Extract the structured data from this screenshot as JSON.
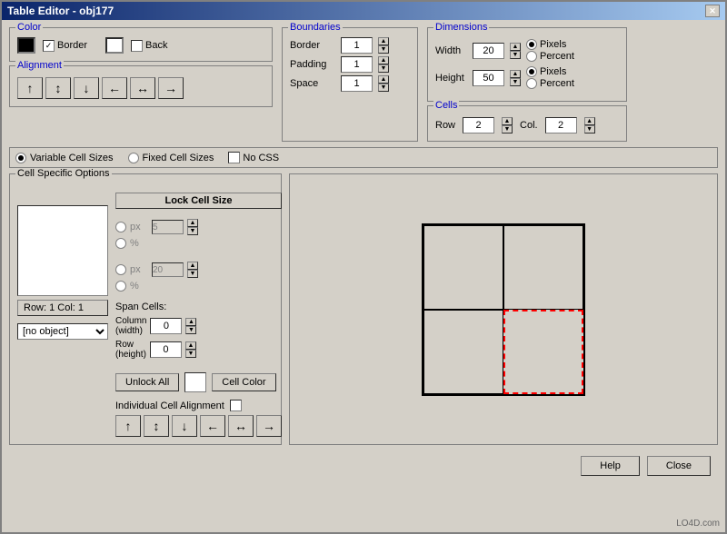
{
  "window": {
    "title": "Table Editor - obj177",
    "close_btn": "✕"
  },
  "color_group": {
    "title": "Color",
    "border_label": "Border",
    "back_label": "Back",
    "border_checked": true,
    "back_checked": false
  },
  "alignment_group": {
    "title": "Alignment",
    "buttons": [
      "↑",
      "↕",
      "↓",
      "←",
      "↔",
      "→"
    ]
  },
  "boundaries_group": {
    "title": "Boundaries",
    "border_label": "Border",
    "border_value": "1",
    "padding_label": "Padding",
    "padding_value": "1",
    "space_label": "Space",
    "space_value": "1"
  },
  "dimensions_group": {
    "title": "Dimensions",
    "width_label": "Width",
    "width_value": "20",
    "height_label": "Height",
    "height_value": "50",
    "pixels_label": "Pixels",
    "percent_label": "Percent",
    "width_pixels_selected": true,
    "height_pixels_selected": true
  },
  "cells_group": {
    "title": "Cells",
    "row_label": "Row",
    "row_value": "2",
    "col_label": "Col.",
    "col_value": "2"
  },
  "cell_sizes": {
    "variable_label": "Variable Cell Sizes",
    "fixed_label": "Fixed Cell Sizes",
    "no_css_label": "No CSS",
    "variable_selected": true
  },
  "cell_options": {
    "title": "Cell Specific Options",
    "lock_btn": "Lock Cell Size",
    "px1_label": "px",
    "percent1_label": "%",
    "px1_value": "5",
    "px2_label": "px",
    "percent2_label": "%",
    "px2_value": "20",
    "span_cells_label": "Span Cells:",
    "column_label": "Column",
    "column_sub": "(width)",
    "column_value": "0",
    "row_label": "Row",
    "row_sub": "(height)",
    "row_value": "0",
    "unlock_btn": "Unlock All",
    "cell_color_btn": "Cell Color",
    "ind_cell_label": "Individual Cell Alignment",
    "align_btns": [
      "↑",
      "↕",
      "↓",
      "←",
      "↔",
      "→"
    ],
    "row_col_info": "Row: 1  Col: 1",
    "no_object": "[no object]"
  },
  "bottom_buttons": {
    "help": "Help",
    "close": "Close"
  },
  "watermark": "LO4D.com"
}
